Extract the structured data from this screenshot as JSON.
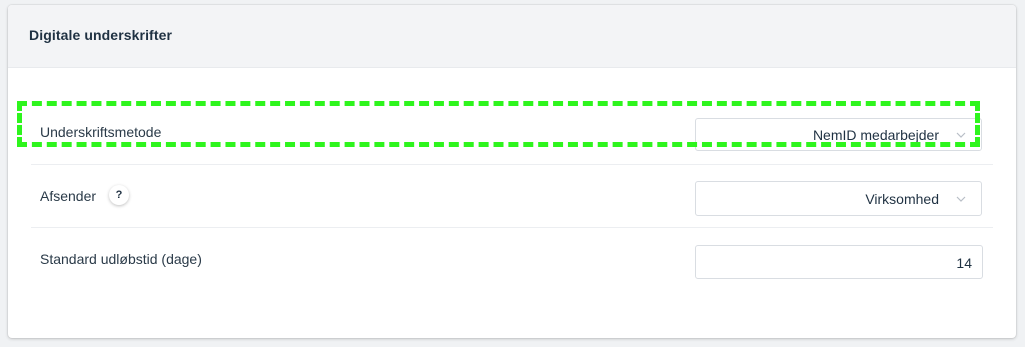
{
  "panel": {
    "title": "Digitale underskrifter"
  },
  "rows": [
    {
      "label": "Underskriftsmetode",
      "control": "select",
      "value": "NemID medarbejder",
      "highlighted": true
    },
    {
      "label": "Afsender",
      "help_icon": "question-icon",
      "help_text": "?",
      "control": "select",
      "value": "Virksomhed"
    },
    {
      "label": "Standard udløbstid (dage)",
      "control": "number-input",
      "value": "14"
    }
  ],
  "colors": {
    "highlight": "#2ef51d",
    "title_text": "#1f3142",
    "header_bg": "#f3f4f6"
  }
}
